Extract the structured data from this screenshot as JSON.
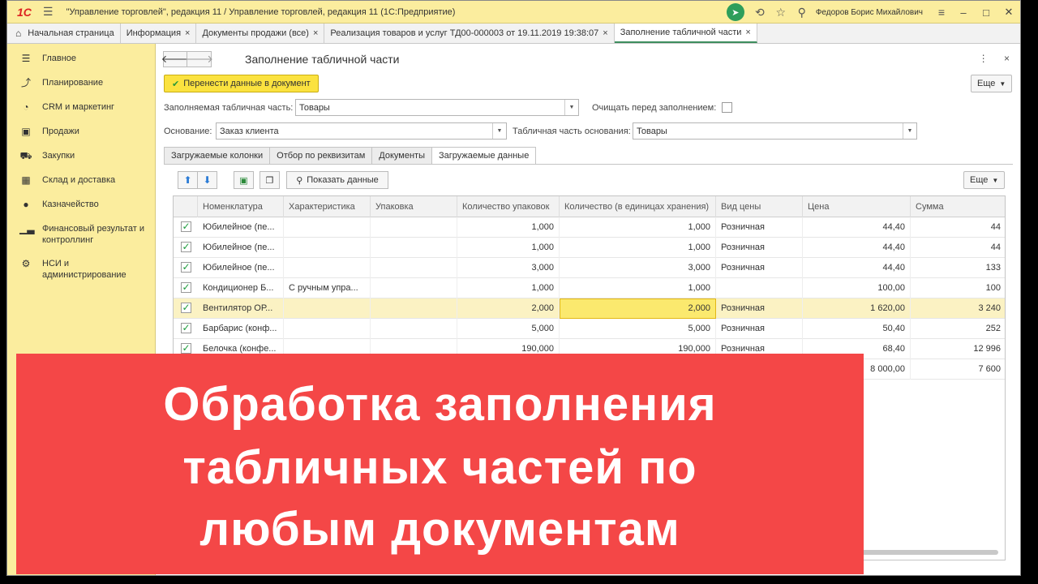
{
  "titlebar": {
    "logo": "1С",
    "title": "\"Управление торговлей\", редакция 11 / Управление торговлей, редакция 11  (1С:Предприятие)",
    "user": "Федоров Борис Михайлович"
  },
  "tabs": [
    {
      "label": "Начальная страница"
    },
    {
      "label": "Информация"
    },
    {
      "label": "Документы продажи (все)"
    },
    {
      "label": "Реализация товаров и услуг ТД00-000003 от 19.11.2019 19:38:07"
    },
    {
      "label": "Заполнение табличной части"
    }
  ],
  "sidebar": {
    "items": [
      {
        "label": "Главное",
        "icon": "menu-lines-icon"
      },
      {
        "label": "Планирование",
        "icon": "planning-icon"
      },
      {
        "label": "CRM и маркетинг",
        "icon": "pie-chart-icon"
      },
      {
        "label": "Продажи",
        "icon": "shopping-bag-icon"
      },
      {
        "label": "Закупки",
        "icon": "cart-icon"
      },
      {
        "label": "Склад и доставка",
        "icon": "warehouse-icon"
      },
      {
        "label": "Казначейство",
        "icon": "coin-icon"
      },
      {
        "label": "Финансовый результат и контроллинг",
        "icon": "bar-chart-icon"
      },
      {
        "label": "НСИ и администрирование",
        "icon": "gear-icon"
      }
    ]
  },
  "form": {
    "title": "Заполнение табличной части",
    "transfer_button": "Перенести данные в документ",
    "more_button": "Еще",
    "fill_table_label": "Заполняемая табличная часть:",
    "fill_table_value": "Товары",
    "clear_label": "Очищать перед заполнением:",
    "basis_label": "Основание:",
    "basis_value": "Заказ клиента",
    "basis_table_label": "Табличная часть основания:",
    "basis_table_value": "Товары",
    "tabs": [
      "Загружаемые колонки",
      "Отбор по реквизитам",
      "Документы",
      "Загружаемые данные"
    ],
    "show_data_button": "Показать данные",
    "table_more_button": "Еще"
  },
  "table": {
    "columns": [
      "Номенклатура",
      "Характеристика",
      "Упаковка",
      "Количество упаковок",
      "Количество (в единицах хранения)",
      "Вид цены",
      "Цена",
      "Сумма"
    ],
    "rows": [
      {
        "name": "Юбилейное (пе...",
        "char": "",
        "pack": "",
        "qty_pack": "1,000",
        "qty": "1,000",
        "price_type": "Розничная",
        "price": "44,40",
        "sum": "44"
      },
      {
        "name": "Юбилейное (пе...",
        "char": "",
        "pack": "",
        "qty_pack": "1,000",
        "qty": "1,000",
        "price_type": "Розничная",
        "price": "44,40",
        "sum": "44"
      },
      {
        "name": "Юбилейное (пе...",
        "char": "",
        "pack": "",
        "qty_pack": "3,000",
        "qty": "3,000",
        "price_type": "Розничная",
        "price": "44,40",
        "sum": "133"
      },
      {
        "name": "Кондиционер Б...",
        "char": "С ручным упра...",
        "pack": "",
        "qty_pack": "1,000",
        "qty": "1,000",
        "price_type": "",
        "price": "100,00",
        "sum": "100"
      },
      {
        "name": "Вентилятор ОР...",
        "char": "",
        "pack": "",
        "qty_pack": "2,000",
        "qty": "2,000",
        "price_type": "Розничная",
        "price": "1 620,00",
        "sum": "3 240"
      },
      {
        "name": "Барбарис (конф...",
        "char": "",
        "pack": "",
        "qty_pack": "5,000",
        "qty": "5,000",
        "price_type": "Розничная",
        "price": "50,40",
        "sum": "252"
      },
      {
        "name": "Белочка (конфе...",
        "char": "",
        "pack": "",
        "qty_pack": "190,000",
        "qty": "190,000",
        "price_type": "Розничная",
        "price": "68,40",
        "sum": "12 996"
      },
      {
        "name": "",
        "char": "",
        "pack": "",
        "qty_pack": "",
        "qty": "",
        "price_type": "",
        "price": "8 000,00",
        "sum": "7 600"
      }
    ]
  },
  "banner": {
    "lines": [
      "Обработка заполнения",
      "табличных частей по",
      "любым документам"
    ],
    "color": "#f44747"
  }
}
